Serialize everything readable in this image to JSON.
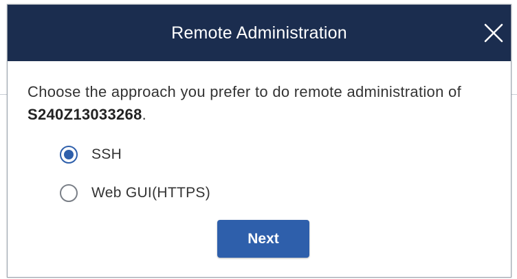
{
  "dialog": {
    "title": "Remote Administration",
    "prompt_prefix": "Choose the approach you prefer to do remote administration of ",
    "device_id": "S240Z13033268",
    "prompt_suffix": ".",
    "options": [
      {
        "label": "SSH",
        "selected": true
      },
      {
        "label": "Web GUI(HTTPS)",
        "selected": false
      }
    ],
    "next_label": "Next"
  },
  "colors": {
    "header_bg": "#1b2d4f",
    "accent": "#2e5fab"
  },
  "icons": {
    "close": "close-icon"
  }
}
